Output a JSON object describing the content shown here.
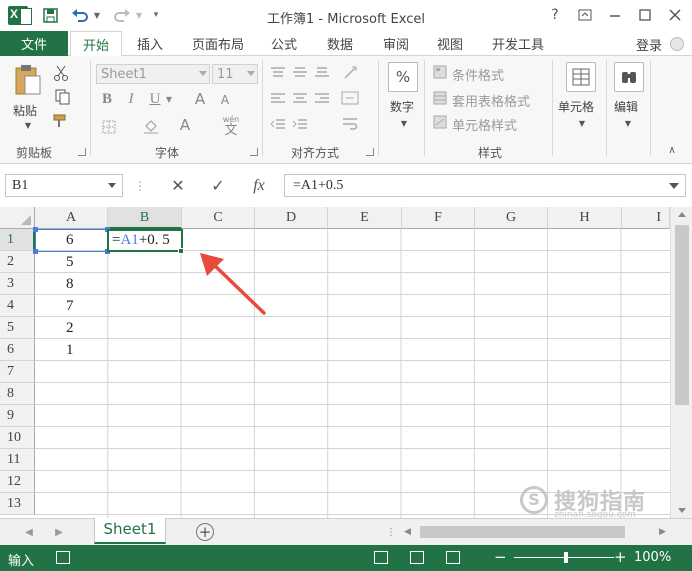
{
  "window": {
    "title": "工作簿1 - Microsoft Excel",
    "logo_text": "X",
    "help": "?",
    "colors": {
      "accent": "#217346",
      "ref": "#4d7ddc",
      "arrow": "#e84b3c"
    }
  },
  "tabs": {
    "file": "文件",
    "items": [
      "开始",
      "插入",
      "页面布局",
      "公式",
      "数据",
      "审阅",
      "视图",
      "开发工具"
    ],
    "active": "开始",
    "login": "登录"
  },
  "ribbon": {
    "clipboard": {
      "paste": "粘贴",
      "group": "剪贴板"
    },
    "font": {
      "name": "Sheet1",
      "size": "11",
      "bold": "B",
      "italic": "I",
      "underline": "U",
      "grow": "A",
      "shrink": "A",
      "color": "A",
      "wen": "wén",
      "zi": "文",
      "group": "字体"
    },
    "align": {
      "group": "对齐方式"
    },
    "number": {
      "label": "数字",
      "symbol": "%"
    },
    "styles": {
      "cond": "条件格式",
      "table": "套用表格格式",
      "cell": "单元格样式",
      "group": "样式"
    },
    "cells": {
      "label": "单元格"
    },
    "editing": {
      "label": "编辑"
    }
  },
  "formula_bar": {
    "name_box": "B1",
    "cancel": "✕",
    "enter": "✓",
    "fx": "fx",
    "formula": "=A1+0.5"
  },
  "sheet": {
    "columns": [
      "A",
      "B",
      "C",
      "D",
      "E",
      "F",
      "G",
      "H",
      "I"
    ],
    "selected_column": "B",
    "rows": [
      "1",
      "2",
      "3",
      "4",
      "5",
      "6",
      "7",
      "8",
      "9",
      "10",
      "11",
      "12",
      "13"
    ],
    "selected_row": "1",
    "column_a": [
      "6",
      "5",
      "8",
      "7",
      "2",
      "1"
    ],
    "edit": {
      "prefix": "=",
      "ref": "A1",
      "suffix": "+0. 5"
    }
  },
  "sheet_tabs": {
    "active": "Sheet1",
    "add": "+"
  },
  "status": {
    "mode": "输入",
    "zoom": "100%"
  },
  "watermark": {
    "symbol": "S",
    "brand": "搜狗指南",
    "url": "zhinan.sogou.com"
  }
}
